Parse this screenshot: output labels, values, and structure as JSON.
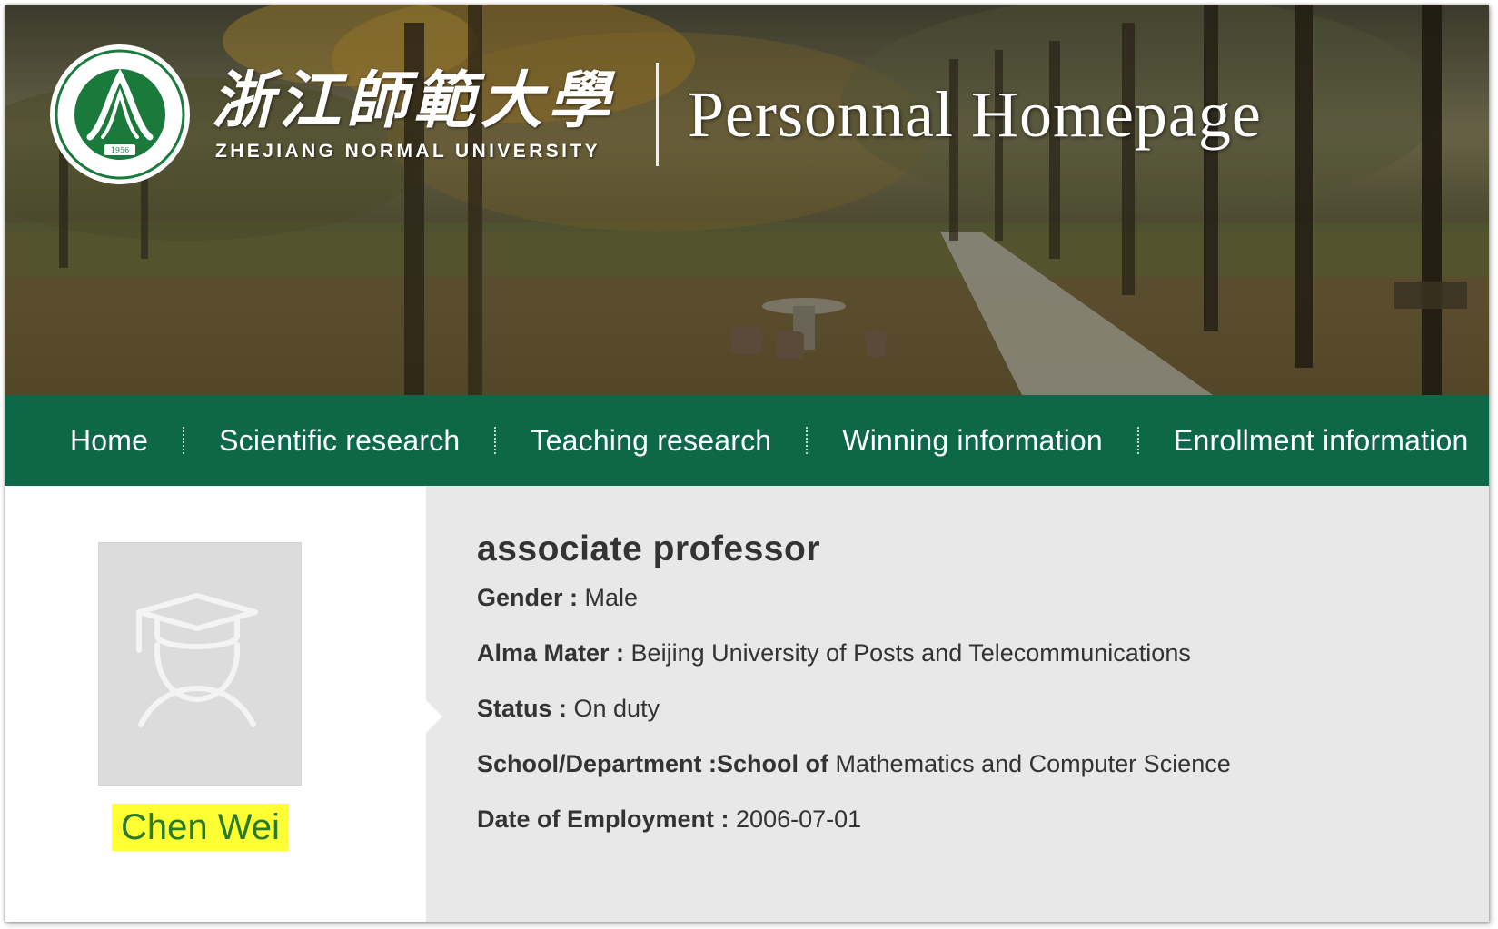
{
  "banner": {
    "university_cn": "浙江師範大學",
    "university_en": "ZHEJIANG NORMAL UNIVERSITY",
    "title": "Personnal Homepage",
    "logo_year": "1956",
    "logo_ring_text": "ZHEJIANG NORMAL UNIVERSITY"
  },
  "nav": {
    "items": [
      {
        "label": "Home"
      },
      {
        "label": "Scientific research"
      },
      {
        "label": "Teaching research"
      },
      {
        "label": "Winning information"
      },
      {
        "label": "Enrollment information"
      }
    ]
  },
  "profile": {
    "name": "Chen Wei",
    "avatar_icon": "graduate-avatar-icon",
    "title": "associate professor",
    "fields": [
      {
        "label": "Gender : ",
        "value": "Male"
      },
      {
        "label": "Alma Mater : ",
        "value": "Beijing University of Posts and Telecommunications"
      },
      {
        "label": "Status : ",
        "value": "On duty"
      },
      {
        "label": "School/Department :School of ",
        "value": "Mathematics and Computer Science"
      },
      {
        "label": "Date of Employment : ",
        "value": "2006-07-01"
      }
    ]
  },
  "colors": {
    "nav_green": "#0c6847",
    "name_highlight": "#ffff33",
    "name_text": "#2a7a2a",
    "info_bg": "#e8e8e8",
    "text": "#333333"
  }
}
